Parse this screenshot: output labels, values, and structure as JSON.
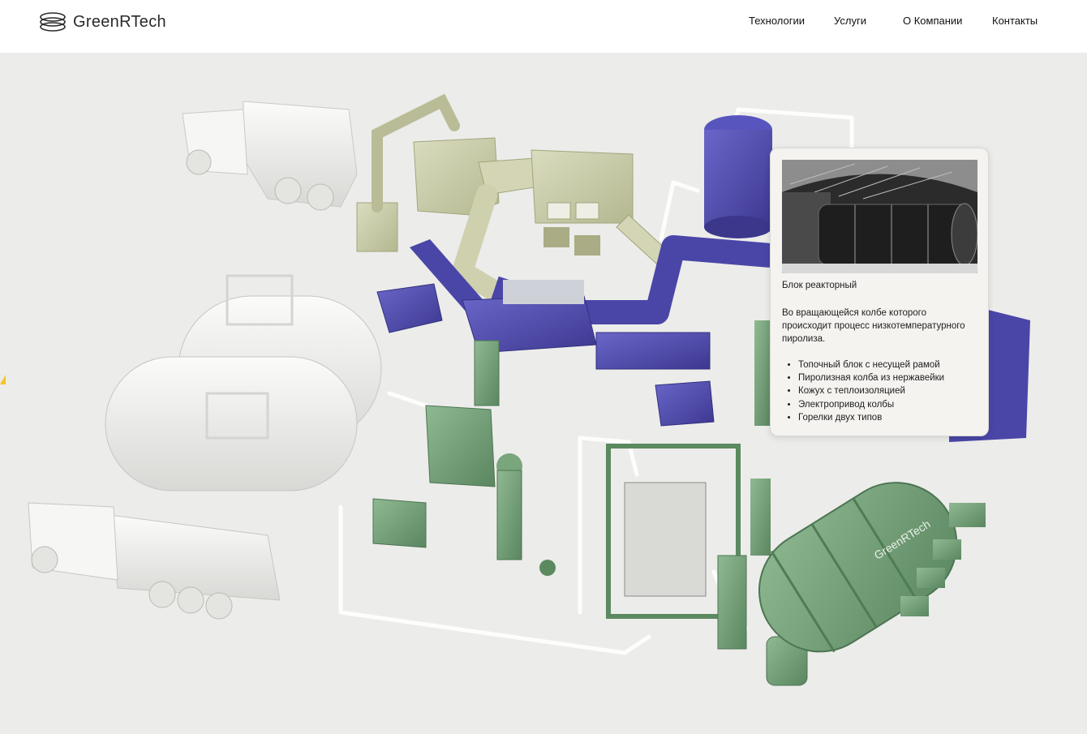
{
  "brand": {
    "name": "GreenRTech",
    "icon": "greenrtech-logo-icon"
  },
  "nav": [
    {
      "label": "Технологии"
    },
    {
      "label": "Услуги"
    },
    {
      "label": "О Компании"
    },
    {
      "label": "Контакты"
    }
  ],
  "scene": {
    "tank_logo": "GreenRTech",
    "colors": {
      "green": "#6f9c72",
      "purple": "#4a46a8",
      "olive": "#c9cca8",
      "white": "#f2f2f0",
      "background": "#ececea"
    }
  },
  "info_card": {
    "title": "Блок реакторный",
    "description": "Во вращающейся колбе которого происходит процесс низкотемпературного пиролиза.",
    "features": [
      "Топочный блок с несущей рамой",
      "Пиролизная колба из нержавейки",
      "Кожух с теплоизоляцией",
      "Электропривод колбы",
      "Горелки двух типов"
    ]
  }
}
